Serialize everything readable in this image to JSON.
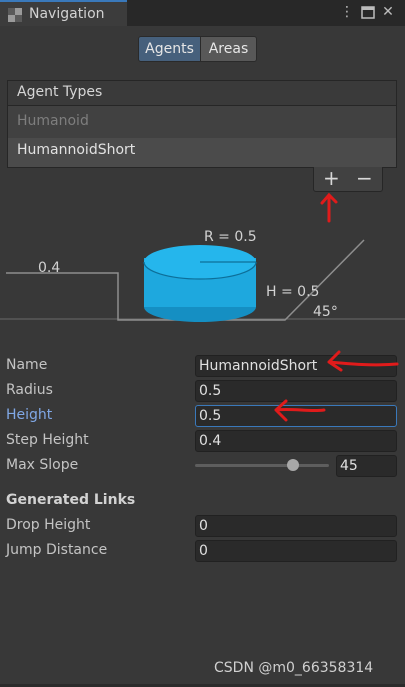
{
  "window": {
    "tab_title": "Navigation",
    "menu_icon": "kebab-icon",
    "maximize_icon": "maximize-icon",
    "close_icon": "close-icon"
  },
  "tabs": [
    {
      "label": "Agents",
      "active": true
    },
    {
      "label": "Areas",
      "active": false
    }
  ],
  "agent_types": {
    "header": "Agent Types",
    "items": [
      {
        "label": "Humanoid",
        "selected": false
      },
      {
        "label": "HumannoidShort",
        "selected": true
      }
    ],
    "add_label": "+",
    "remove_label": "−"
  },
  "diagram": {
    "step_label": "0.4",
    "radius_label": "R = 0.5",
    "height_label": "H = 0.5",
    "slope_label": "45°"
  },
  "fields": {
    "name": {
      "label": "Name",
      "value": "HumannoidShort"
    },
    "radius": {
      "label": "Radius",
      "value": "0.5"
    },
    "height": {
      "label": "Height",
      "value": "0.5"
    },
    "step_height": {
      "label": "Step Height",
      "value": "0.4"
    },
    "max_slope": {
      "label": "Max Slope",
      "value": "45",
      "slider_fraction": 0.75
    }
  },
  "generated_links": {
    "title": "Generated Links",
    "drop_height": {
      "label": "Drop Height",
      "value": "0"
    },
    "jump_distance": {
      "label": "Jump Distance",
      "value": "0"
    }
  },
  "watermark": "CSDN @m0_66358314",
  "colors": {
    "accent": "#3a79bb",
    "annotation": "#e01b1b",
    "cylinder": "#1ea8de",
    "focused_label": "#80a8e6"
  }
}
